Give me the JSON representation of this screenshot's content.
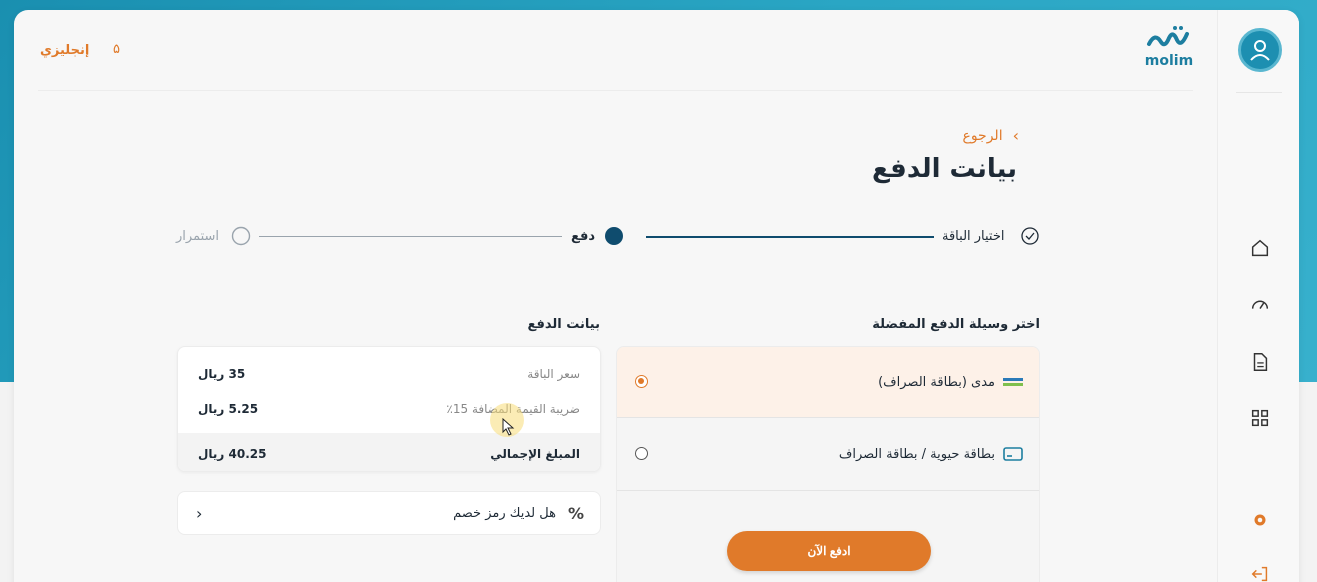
{
  "header": {
    "language_label": "إنجليزي",
    "bell_label": "۵",
    "logo_word": "molim"
  },
  "nav": {
    "back_label": "الرجوع",
    "page_title": "بيانت الدفع"
  },
  "stepper": {
    "steps": [
      {
        "label": "اختيار الباقة",
        "state": "done"
      },
      {
        "label": "دفع",
        "state": "current"
      },
      {
        "label": "استمرار",
        "state": "pending"
      }
    ]
  },
  "payment_methods": {
    "title": "اختر وسيلة الدفع المفضلة",
    "items": [
      {
        "label": "مدى (بطاقة الصراف)",
        "icon": "mada-card-icon",
        "selected": true
      },
      {
        "label": "بطاقة حيوية / بطاقة الصراف",
        "icon": "credit-card-icon",
        "selected": false
      }
    ],
    "pay_button": "ادفع الآن"
  },
  "summary": {
    "title": "بيانت الدفع",
    "rows": [
      {
        "label": "سعر الباقة",
        "value": "35 ريال"
      },
      {
        "label": "ضريبة القيمة المضافة 15٪",
        "value": "5.25 ريال"
      }
    ],
    "total_label": "المبلغ الإجمالي",
    "total_value": "40.25 ريال"
  },
  "coupon": {
    "label": "هل لديك رمز خصم",
    "icon": "percent-icon"
  },
  "colors": {
    "accent": "#e07a2a",
    "brand": "#1d7ea0",
    "dark_step": "#0f4c6e"
  }
}
